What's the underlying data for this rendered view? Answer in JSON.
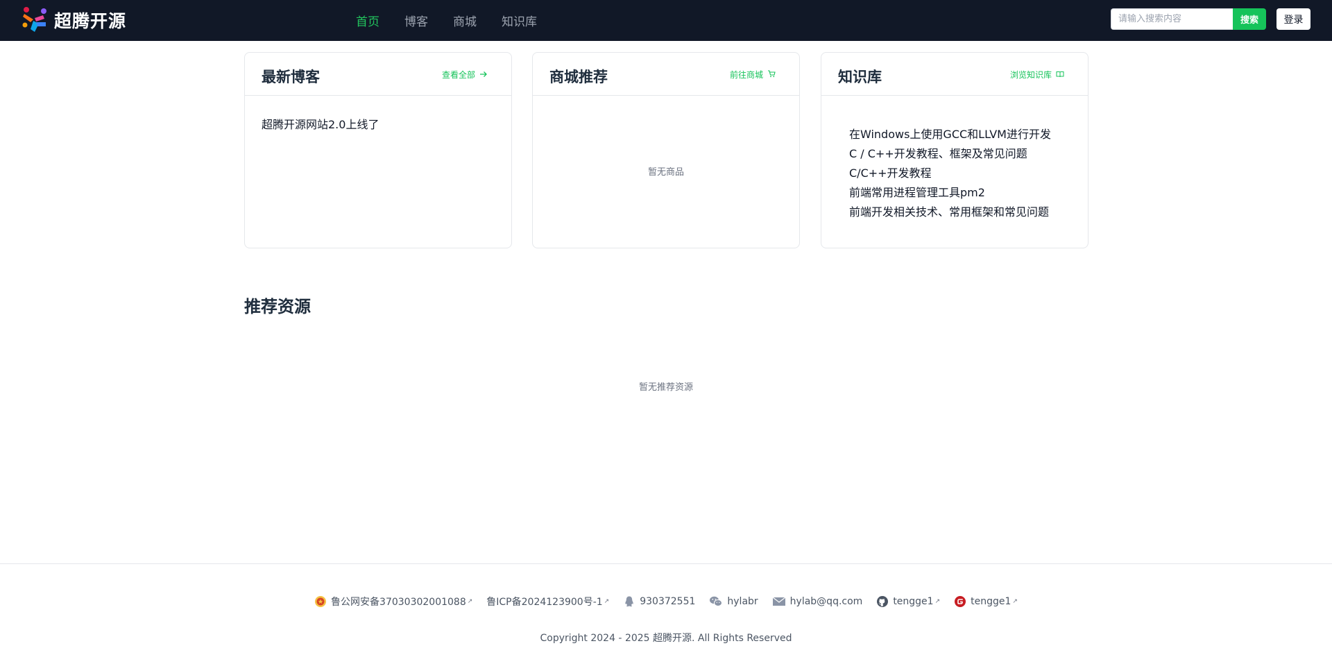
{
  "header": {
    "logo_text": "超腾开源",
    "nav": [
      {
        "label": "首页",
        "active": true
      },
      {
        "label": "博客",
        "active": false
      },
      {
        "label": "商城",
        "active": false
      },
      {
        "label": "知识库",
        "active": false
      }
    ],
    "search": {
      "placeholder": "请输入搜索内容",
      "value": "",
      "button_label": "搜索"
    },
    "login_label": "登录",
    "colors": {
      "background": "#111827",
      "accent": "#22c55e"
    }
  },
  "cards": {
    "blog": {
      "title": "最新博客",
      "link_label": "查看全部",
      "link_icon": "arrow-right-icon",
      "items": [
        "超腾开源网站2.0上线了"
      ]
    },
    "shop": {
      "title": "商城推荐",
      "link_label": "前往商城",
      "link_icon": "cart-icon",
      "empty_text": "暂无商品"
    },
    "kb": {
      "title": "知识库",
      "link_label": "浏览知识库",
      "link_icon": "book-icon",
      "items": [
        "在Windows上使用GCC和LLVM进行开发",
        "C / C++开发教程、框架及常见问题",
        "C/C++开发教程",
        "前端常用进程管理工具pm2",
        "前端开发相关技术、常用框架和常见问题"
      ]
    }
  },
  "resources": {
    "title": "推荐资源",
    "empty_text": "暂无推荐资源"
  },
  "footer": {
    "links": [
      {
        "icon": "police-badge-icon",
        "label": "鲁公网安备37030302001088",
        "external": true
      },
      {
        "icon": "",
        "label": "鲁ICP备2024123900号-1",
        "external": true
      },
      {
        "icon": "qq-icon",
        "label": "930372551",
        "external": false
      },
      {
        "icon": "wechat-icon",
        "label": "hylabr",
        "external": false
      },
      {
        "icon": "mail-icon",
        "label": "hylab@qq.com",
        "external": false
      },
      {
        "icon": "github-icon",
        "label": "tengge1",
        "external": true
      },
      {
        "icon": "gitee-icon",
        "label": "tengge1",
        "external": true
      }
    ],
    "copyright": "Copyright 2024 - 2025 超腾开源. All Rights Reserved"
  }
}
